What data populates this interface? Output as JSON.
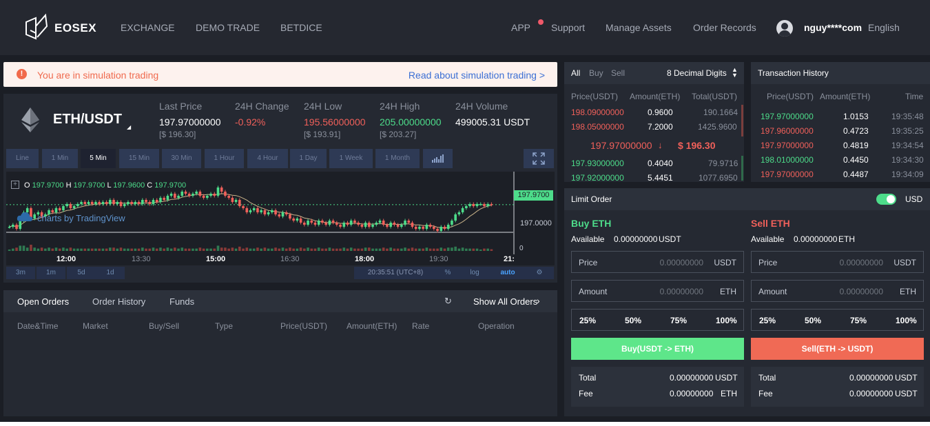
{
  "header": {
    "brand": "EOSEX",
    "nav": [
      "EXCHANGE",
      "DEMO TRADE",
      "BETDICE"
    ],
    "right_nav": [
      "APP",
      "Support",
      "Manage Assets",
      "Order Records"
    ],
    "user": "nguy****com",
    "language": "English"
  },
  "notice": {
    "text": "You are in simulation trading",
    "link": "Read about simulation trading >"
  },
  "ticker": {
    "pair": "ETH/USDT",
    "last_price_label": "Last Price",
    "last_price": "197.97000000",
    "last_price_usd": "[$ 196.30]",
    "change_label": "24H Change",
    "change": "-0.92%",
    "low_label": "24H Low",
    "low": "195.56000000",
    "low_usd": "[$ 193.91]",
    "high_label": "24H High",
    "high": "205.00000000",
    "high_usd": "[$ 203.27]",
    "volume_label": "24H Volume",
    "volume": "499005.31 USDT"
  },
  "chart_controls": {
    "timeframes": [
      "Line",
      "1 Min",
      "5 Min",
      "15 Min",
      "30 Min",
      "1 Hour",
      "4 Hour",
      "1 Day",
      "1 Week",
      "1 Month"
    ],
    "active_timeframe": "5 Min",
    "zoom": [
      "3m",
      "1m",
      "5d",
      "1d"
    ],
    "clock": "20:35:51 (UTC+8)",
    "pct": "%",
    "log": "log",
    "auto": "auto"
  },
  "chart_data": {
    "type": "candlestick",
    "ohlc_legend": {
      "o_label": "O",
      "o": "197.9700",
      "h_label": "H",
      "h": "197.9700",
      "l_label": "L",
      "l": "197.9600",
      "c_label": "C",
      "c": "197.9700"
    },
    "watermark": "charts by TradingView",
    "x_ticks": [
      "12:00",
      "13:30",
      "15:00",
      "16:30",
      "18:00",
      "19:30",
      "21:"
    ],
    "y_ticks": [
      "197.0000"
    ],
    "volume_ticks": [
      "0"
    ],
    "last_price_label": "197.9700",
    "closes": [
      196.9,
      197.0,
      196.8,
      197.2,
      197.6,
      197.8,
      197.3,
      197.5,
      197.6,
      197.4,
      197.5,
      197.7,
      197.6,
      197.8,
      197.7,
      197.9,
      198.0,
      197.8,
      197.9,
      198.0,
      198.1,
      198.0,
      198.1,
      198.0,
      198.1,
      198.0,
      198.1,
      198.0,
      198.2,
      198.0,
      198.1,
      197.9,
      198.0,
      198.1,
      198.0,
      198.1,
      198.0,
      198.2,
      198.1,
      198.0,
      198.2,
      198.1,
      198.3,
      198.2,
      198.4,
      198.5,
      198.3,
      198.4,
      198.6,
      198.5,
      198.4,
      198.5,
      198.6,
      198.4,
      198.3,
      198.4,
      198.5,
      198.4,
      198.8,
      198.6,
      198.4,
      198.3,
      198.1,
      198.2,
      197.9,
      197.8,
      197.6,
      197.7,
      197.8,
      197.6,
      197.7,
      197.5,
      197.6,
      197.7,
      197.5,
      197.4,
      197.6,
      197.5,
      197.3,
      197.2,
      197.3,
      197.1,
      197.0,
      197.2,
      197.1,
      197.0,
      197.2,
      197.1,
      197.0,
      197.2,
      197.1,
      197.0,
      196.9,
      197.1,
      197.0,
      197.2,
      197.1,
      197.0,
      196.9,
      197.1,
      196.9,
      197.0,
      197.1,
      197.2,
      197.0,
      196.9,
      197.1,
      197.0,
      196.9,
      197.0,
      197.2,
      197.1,
      196.9,
      196.8,
      196.9,
      196.8,
      197.0,
      196.9,
      196.8,
      196.7,
      196.9,
      196.8,
      197.0,
      197.2,
      197.5,
      197.6,
      197.8,
      197.9,
      198.0,
      197.9,
      198.0,
      198.0,
      197.9,
      198.0,
      197.97
    ]
  },
  "open_orders": {
    "tabs": [
      "Open Orders",
      "Order History",
      "Funds"
    ],
    "show_all": "Show All Orders",
    "columns": [
      "Date&Time",
      "Market",
      "Buy/Sell",
      "Type",
      "Price(USDT)",
      "Amount(ETH)",
      "Rate",
      "Operation"
    ]
  },
  "orderbook": {
    "filters": [
      "All",
      "Buy",
      "Sell"
    ],
    "digits": "8 Decimal Digits",
    "columns": [
      "Price(USDT)",
      "Amount(ETH)",
      "Total(USDT)"
    ],
    "asks": [
      {
        "price": "198.09000000",
        "amount": "0.9600",
        "total": "190.1664"
      },
      {
        "price": "198.05000000",
        "amount": "7.2000",
        "total": "1425.9600"
      }
    ],
    "mid_price": "197.97000000",
    "mid_arrow": "↓",
    "mid_usd": "$ 196.30",
    "bids": [
      {
        "price": "197.93000000",
        "amount": "0.4040",
        "total": "79.9716"
      },
      {
        "price": "197.92000000",
        "amount": "5.4451",
        "total": "1077.6950"
      }
    ]
  },
  "history": {
    "title": "Transaction History",
    "columns": [
      "Price(USDT)",
      "Amount(ETH)",
      "Time"
    ],
    "rows": [
      {
        "price": "197.97000000",
        "amount": "1.0153",
        "time": "19:35:48",
        "side": "buy"
      },
      {
        "price": "197.96000000",
        "amount": "0.4723",
        "time": "19:35:25",
        "side": "sell"
      },
      {
        "price": "197.97000000",
        "amount": "0.4819",
        "time": "19:34:54",
        "side": "sell"
      },
      {
        "price": "198.01000000",
        "amount": "0.4450",
        "time": "19:34:30",
        "side": "buy"
      },
      {
        "price": "197.97000000",
        "amount": "0.4487",
        "time": "19:34:09",
        "side": "sell"
      }
    ]
  },
  "limit_order": {
    "title": "Limit Order",
    "currency": "USD",
    "buy": {
      "title": "Buy ETH",
      "available_label": "Available",
      "available": "0.00000000",
      "available_unit": "USDT",
      "price_label": "Price",
      "price": "0.00000000",
      "price_unit": "USDT",
      "amount_label": "Amount",
      "amount": "0.00000000",
      "amount_unit": "ETH",
      "button": "Buy(USDT -> ETH)",
      "total_label": "Total",
      "total": "0.00000000",
      "total_unit": "USDT",
      "fee_label": "Fee",
      "fee": "0.00000000",
      "fee_unit": "ETH"
    },
    "sell": {
      "title": "Sell ETH",
      "available_label": "Available",
      "available": "0.00000000",
      "available_unit": "ETH",
      "price_label": "Price",
      "price": "0.00000000",
      "price_unit": "USDT",
      "amount_label": "Amount",
      "amount": "0.00000000",
      "amount_unit": "ETH",
      "button": "Sell(ETH -> USDT)",
      "total_label": "Total",
      "total": "0.00000000",
      "total_unit": "USDT",
      "fee_label": "Fee",
      "fee": "0.00000000",
      "fee_unit": "USDT"
    },
    "percents": [
      "25%",
      "50%",
      "75%",
      "100%"
    ]
  },
  "colors": {
    "green": "#4ddc8a",
    "red": "#f0605a",
    "buy_button": "#5ee68a",
    "sell_button": "#f06a55",
    "link": "#3b6fd4"
  }
}
